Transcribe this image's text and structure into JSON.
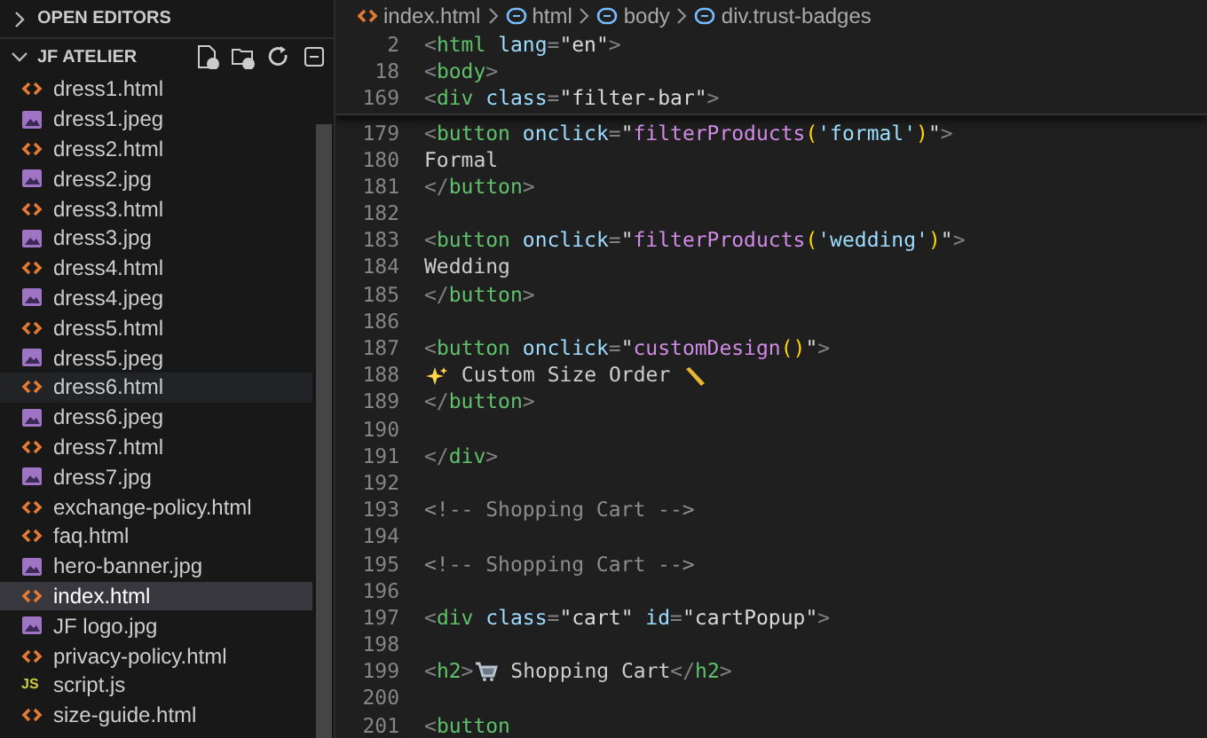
{
  "sidebar": {
    "sections": [
      {
        "title": "OPEN EDITORS",
        "expanded": false
      },
      {
        "title": "JF ATELIER",
        "expanded": true
      }
    ],
    "files": [
      {
        "name": "dress1.html",
        "kind": "html",
        "selected": false,
        "hovered": false
      },
      {
        "name": "dress1.jpeg",
        "kind": "image",
        "selected": false,
        "hovered": false
      },
      {
        "name": "dress2.html",
        "kind": "html",
        "selected": false,
        "hovered": false
      },
      {
        "name": "dress2.jpg",
        "kind": "image",
        "selected": false,
        "hovered": false
      },
      {
        "name": "dress3.html",
        "kind": "html",
        "selected": false,
        "hovered": false
      },
      {
        "name": "dress3.jpg",
        "kind": "image",
        "selected": false,
        "hovered": false
      },
      {
        "name": "dress4.html",
        "kind": "html",
        "selected": false,
        "hovered": false
      },
      {
        "name": "dress4.jpeg",
        "kind": "image",
        "selected": false,
        "hovered": false
      },
      {
        "name": "dress5.html",
        "kind": "html",
        "selected": false,
        "hovered": false
      },
      {
        "name": "dress5.jpeg",
        "kind": "image",
        "selected": false,
        "hovered": false
      },
      {
        "name": "dress6.html",
        "kind": "html",
        "selected": false,
        "hovered": true
      },
      {
        "name": "dress6.jpeg",
        "kind": "image",
        "selected": false,
        "hovered": false
      },
      {
        "name": "dress7.html",
        "kind": "html",
        "selected": false,
        "hovered": false
      },
      {
        "name": "dress7.jpg",
        "kind": "image",
        "selected": false,
        "hovered": false
      },
      {
        "name": "exchange-policy.html",
        "kind": "html",
        "selected": false,
        "hovered": false
      },
      {
        "name": "faq.html",
        "kind": "html",
        "selected": false,
        "hovered": false
      },
      {
        "name": "hero-banner.jpg",
        "kind": "image",
        "selected": false,
        "hovered": false
      },
      {
        "name": "index.html",
        "kind": "html",
        "selected": true,
        "hovered": false
      },
      {
        "name": "JF logo.jpg",
        "kind": "image",
        "selected": false,
        "hovered": false
      },
      {
        "name": "privacy-policy.html",
        "kind": "html",
        "selected": false,
        "hovered": false
      },
      {
        "name": "script.js",
        "kind": "js",
        "badge": "JS",
        "selected": false,
        "hovered": false
      },
      {
        "name": "size-guide.html",
        "kind": "html",
        "selected": false,
        "hovered": false
      }
    ]
  },
  "breadcrumb": [
    "index.html",
    "html",
    "body",
    "div.trust-badges"
  ],
  "sticky_lines": [
    {
      "number": "2",
      "tokens": [
        {
          "text": "<",
          "kind": "punct"
        },
        {
          "text": "html",
          "kind": "tag"
        },
        {
          "text": " lang",
          "kind": "attr"
        },
        {
          "text": "=",
          "kind": "punct"
        },
        {
          "text": "\"en\"",
          "kind": "string"
        },
        {
          "text": ">",
          "kind": "punct"
        }
      ]
    },
    {
      "number": "18",
      "tokens": [
        {
          "text": "<",
          "kind": "punct"
        },
        {
          "text": "body",
          "kind": "tag"
        },
        {
          "text": ">",
          "kind": "punct"
        }
      ]
    },
    {
      "number": "169",
      "tokens": [
        {
          "text": "<",
          "kind": "punct"
        },
        {
          "text": "div",
          "kind": "tag"
        },
        {
          "text": " class",
          "kind": "attr"
        },
        {
          "text": "=",
          "kind": "punct"
        },
        {
          "text": "\"filter-bar\"",
          "kind": "string"
        },
        {
          "text": ">",
          "kind": "punct"
        }
      ]
    }
  ],
  "lines": [
    {
      "number": "179",
      "tokens": [
        {
          "text": "<",
          "kind": "punct"
        },
        {
          "text": "button",
          "kind": "tag"
        },
        {
          "text": " onclick",
          "kind": "attr"
        },
        {
          "text": "=",
          "kind": "punct"
        },
        {
          "text": "\"",
          "kind": "string"
        },
        {
          "text": "filterProducts",
          "kind": "function"
        },
        {
          "text": "(",
          "kind": "bracket"
        },
        {
          "text": "'formal'",
          "kind": "argument"
        },
        {
          "text": ")",
          "kind": "bracket"
        },
        {
          "text": "\"",
          "kind": "string"
        },
        {
          "text": ">",
          "kind": "punct"
        }
      ]
    },
    {
      "number": "180",
      "tokens": [
        {
          "text": "Formal",
          "kind": "plain"
        }
      ]
    },
    {
      "number": "181",
      "tokens": [
        {
          "text": "</",
          "kind": "punct"
        },
        {
          "text": "button",
          "kind": "tag"
        },
        {
          "text": ">",
          "kind": "punct"
        }
      ]
    },
    {
      "number": "182"
    },
    {
      "number": "183",
      "tokens": [
        {
          "text": "<",
          "kind": "punct"
        },
        {
          "text": "button",
          "kind": "tag"
        },
        {
          "text": " onclick",
          "kind": "attr"
        },
        {
          "text": "=",
          "kind": "punct"
        },
        {
          "text": "\"",
          "kind": "string"
        },
        {
          "text": "filterProducts",
          "kind": "function"
        },
        {
          "text": "(",
          "kind": "bracket"
        },
        {
          "text": "'wedding'",
          "kind": "argument"
        },
        {
          "text": ")",
          "kind": "bracket"
        },
        {
          "text": "\"",
          "kind": "string"
        },
        {
          "text": ">",
          "kind": "punct"
        }
      ]
    },
    {
      "number": "184",
      "tokens": [
        {
          "text": "Wedding",
          "kind": "plain"
        }
      ]
    },
    {
      "number": "185",
      "tokens": [
        {
          "text": "</",
          "kind": "punct"
        },
        {
          "text": "button",
          "kind": "tag"
        },
        {
          "text": ">",
          "kind": "punct"
        }
      ]
    },
    {
      "number": "186"
    },
    {
      "number": "187",
      "tokens": [
        {
          "text": "<",
          "kind": "punct"
        },
        {
          "text": "button",
          "kind": "tag"
        },
        {
          "text": " onclick",
          "kind": "attr"
        },
        {
          "text": "=",
          "kind": "punct"
        },
        {
          "text": "\"",
          "kind": "string"
        },
        {
          "text": "customDesign",
          "kind": "function"
        },
        {
          "text": "()",
          "kind": "bracket"
        },
        {
          "text": "\"",
          "kind": "string"
        },
        {
          "text": ">",
          "kind": "punct"
        }
      ]
    },
    {
      "number": "188",
      "tokens": [
        {
          "kind": "icon"
        },
        {
          "text": " Custom Size Order ",
          "kind": "plain"
        },
        {
          "kind": "icon"
        }
      ]
    },
    {
      "number": "189",
      "tokens": [
        {
          "text": "</",
          "kind": "punct"
        },
        {
          "text": "button",
          "kind": "tag"
        },
        {
          "text": ">",
          "kind": "punct"
        }
      ]
    },
    {
      "number": "190"
    },
    {
      "number": "191",
      "tokens": [
        {
          "text": "</",
          "kind": "punct"
        },
        {
          "text": "div",
          "kind": "tag"
        },
        {
          "text": ">",
          "kind": "punct"
        }
      ]
    },
    {
      "number": "192"
    },
    {
      "number": "193",
      "tokens": [
        {
          "text": "<!-- Shopping Cart -->",
          "kind": "comment"
        }
      ]
    },
    {
      "number": "194"
    },
    {
      "number": "195",
      "tokens": [
        {
          "text": "<!-- Shopping Cart -->",
          "kind": "comment"
        }
      ]
    },
    {
      "number": "196"
    },
    {
      "number": "197",
      "tokens": [
        {
          "text": "<",
          "kind": "punct"
        },
        {
          "text": "div",
          "kind": "tag"
        },
        {
          "text": " class",
          "kind": "attr"
        },
        {
          "text": "=",
          "kind": "punct"
        },
        {
          "text": "\"cart\"",
          "kind": "string"
        },
        {
          "text": " id",
          "kind": "attr"
        },
        {
          "text": "=",
          "kind": "punct"
        },
        {
          "text": "\"cartPopup\"",
          "kind": "string"
        },
        {
          "text": ">",
          "kind": "punct"
        }
      ]
    },
    {
      "number": "198"
    },
    {
      "number": "199",
      "tokens": [
        {
          "text": "<",
          "kind": "punct"
        },
        {
          "text": "h2",
          "kind": "tag"
        },
        {
          "text": ">",
          "kind": "punct"
        },
        {
          "kind": "icon"
        },
        {
          "text": " Shopping Cart",
          "kind": "plain"
        },
        {
          "text": "</",
          "kind": "punct"
        },
        {
          "text": "h2",
          "kind": "tag"
        },
        {
          "text": ">",
          "kind": "punct"
        }
      ]
    },
    {
      "number": "200"
    },
    {
      "number": "201",
      "tokens": [
        {
          "text": "<",
          "kind": "punct"
        },
        {
          "text": "button",
          "kind": "tag"
        }
      ]
    }
  ]
}
